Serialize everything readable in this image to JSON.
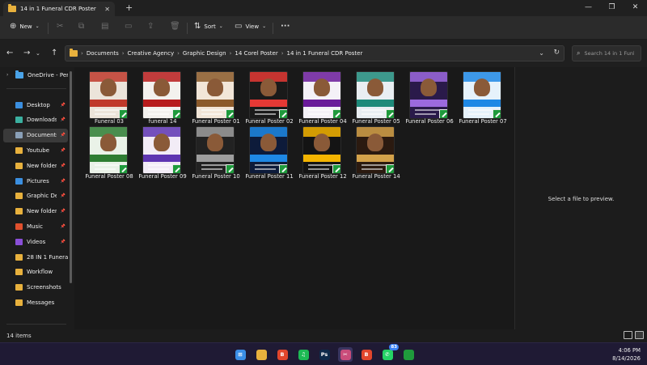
{
  "window": {
    "tab_title": "14 in 1 Funeral CDR Poster",
    "new_tab_glyph": "+",
    "controls": [
      "—",
      "❐",
      "✕"
    ]
  },
  "toolbar": {
    "new_label": "New",
    "sort_label": "Sort",
    "view_label": "View",
    "more_label": "···"
  },
  "address": {
    "path": [
      "Documents",
      "Creative Agency",
      "Graphic Design",
      "14 Corel Poster",
      "14 in 1 Funeral CDR Poster"
    ],
    "search_placeholder": "Search 14 in 1 Funl"
  },
  "sidebar": {
    "onedrive": "OneDrive - Perso",
    "items": [
      {
        "label": "Desktop",
        "icon": "desktop-icon",
        "color": "#3b8fe0",
        "pinned": true
      },
      {
        "label": "Downloads",
        "icon": "download-icon",
        "color": "#3bb0a0",
        "pinned": true
      },
      {
        "label": "Documents",
        "icon": "document-icon",
        "color": "#8aa0b8",
        "pinned": true,
        "selected": true
      },
      {
        "label": "Youtube",
        "icon": "folder-icon",
        "color": "#e8b13d",
        "pinned": true
      },
      {
        "label": "New folder (2",
        "icon": "folder-icon",
        "color": "#e8b13d",
        "pinned": true
      },
      {
        "label": "Pictures",
        "icon": "pictures-icon",
        "color": "#3b8fe0",
        "pinned": true
      },
      {
        "label": "Graphic Desig",
        "icon": "folder-icon",
        "color": "#e8b13d",
        "pinned": true
      },
      {
        "label": "New folder",
        "icon": "folder-icon",
        "color": "#e8b13d",
        "pinned": true
      },
      {
        "label": "Music",
        "icon": "music-icon",
        "color": "#e0502d",
        "pinned": true
      },
      {
        "label": "Videos",
        "icon": "videos-icon",
        "color": "#8a4fd8",
        "pinned": true
      },
      {
        "label": "28 IN 1 Funeral F",
        "icon": "folder-icon",
        "color": "#e8b13d",
        "pinned": false
      },
      {
        "label": "Workflow",
        "icon": "folder-icon",
        "color": "#e8b13d",
        "pinned": false
      },
      {
        "label": "Screenshots",
        "icon": "folder-icon",
        "color": "#e8b13d",
        "pinned": false
      },
      {
        "label": "Messages",
        "icon": "folder-icon",
        "color": "#e8b13d",
        "pinned": false
      }
    ]
  },
  "files": [
    {
      "name": "Funeral 03",
      "bg": "#ece4da",
      "accent": "#c0392b"
    },
    {
      "name": "funeral 14",
      "bg": "#f3f1ee",
      "accent": "#b71c1c"
    },
    {
      "name": "Funeral Poster 01",
      "bg": "#f2e6d8",
      "accent": "#8b5a2b"
    },
    {
      "name": "Funeral Poster 02",
      "bg": "#1a1a1a",
      "accent": "#e53935"
    },
    {
      "name": "Funeral Poster 04",
      "bg": "#f4f1f7",
      "accent": "#6a1b9a"
    },
    {
      "name": "Funeral Poster 05",
      "bg": "#e9eef2",
      "accent": "#1e8a7a"
    },
    {
      "name": "Funeral Poster 06",
      "bg": "#2a1a4a",
      "accent": "#9c6ade"
    },
    {
      "name": "Funeral Poster 07",
      "bg": "#e6f2fb",
      "accent": "#1e88e5"
    },
    {
      "name": "Funeral Poster 08",
      "bg": "#eaf2e8",
      "accent": "#2e7d32"
    },
    {
      "name": "Funeral Poster 09",
      "bg": "#f2ecf6",
      "accent": "#5e35b1"
    },
    {
      "name": "Funeral Poster 10",
      "bg": "#222222",
      "accent": "#9e9e9e"
    },
    {
      "name": "Funeral Poster 11",
      "bg": "#0d1b3a",
      "accent": "#1e88e5"
    },
    {
      "name": "Funeral Poster 12",
      "bg": "#141414",
      "accent": "#f4b400"
    },
    {
      "name": "Funeral Poster 14",
      "bg": "#2b1a10",
      "accent": "#d4a24a"
    }
  ],
  "preview": {
    "message": "Select a file to preview."
  },
  "status": {
    "count": "14 items"
  },
  "taskbar": {
    "apps": [
      {
        "name": "windows-start-icon",
        "label": "⊞",
        "bg": "#3a8ee6"
      },
      {
        "name": "file-explorer-icon",
        "label": "",
        "bg": "#e8b13d"
      },
      {
        "name": "brave-icon",
        "label": "B",
        "bg": "#e2462c"
      },
      {
        "name": "spotify-icon",
        "label": "♫",
        "bg": "#1db954"
      },
      {
        "name": "photoshop-icon",
        "label": "Ps",
        "bg": "#0c2a4a"
      },
      {
        "name": "snipping-tool-icon",
        "label": "✂",
        "bg": "#c94c7a",
        "active": true
      },
      {
        "name": "brave-icon",
        "label": "B",
        "bg": "#e2462c"
      },
      {
        "name": "whatsapp-icon",
        "label": "✆",
        "bg": "#25d366",
        "badge": "83"
      },
      {
        "name": "coreldraw-icon",
        "label": "",
        "bg": "#1f9a3c"
      }
    ],
    "time": "4:06 PM",
    "date": "8/14/2026"
  }
}
